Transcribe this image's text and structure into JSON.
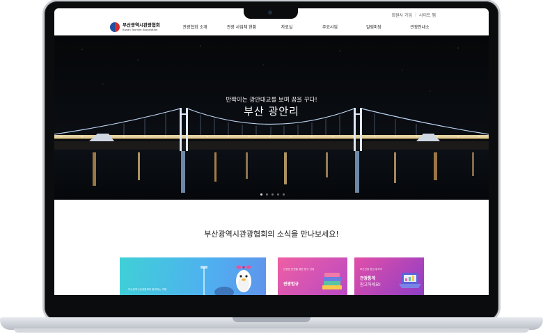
{
  "header": {
    "util_links": [
      "회원사 가입",
      "사이트 맵"
    ],
    "logo": {
      "name_ko": "부산광역시관광협회",
      "name_en": "Busan Tourism Association",
      "badge": "BTA"
    },
    "nav": [
      "관광협회 소개",
      "관광 사업체 현황",
      "자료실",
      "주요사업",
      "알림마당",
      "관광안내소"
    ]
  },
  "hero": {
    "subtitle": "반짝이는 광안대교를 보며 꿈을 꾸다!",
    "title": "부산 광안리",
    "slide_count": 5,
    "active_slide": 1
  },
  "news": {
    "heading": "부산광역시관광협회의 소식을 만나보세요!",
    "cards": [
      {
        "small_text": "부산광역시관광협회와 함께하는 여행",
        "colors": [
          "#3fd0d7",
          "#5f94ec"
        ]
      },
      {
        "small_text": "관광업 운영을 위한 법규 안내",
        "label": "관광법규",
        "colors": [
          "#ef5fa3",
          "#b94ac3"
        ]
      },
      {
        "small_text": "부산관광 한눈에 보기",
        "label": "관광통계",
        "label2": "참고하세요!",
        "colors": [
          "#e24fa8",
          "#8e3ec6"
        ]
      }
    ]
  }
}
